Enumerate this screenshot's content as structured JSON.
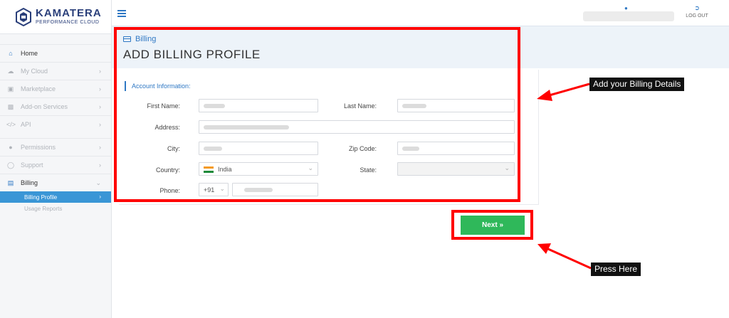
{
  "brand": {
    "name": "KAMATERA",
    "tagline": "PERFORMANCE CLOUD"
  },
  "sidebar": {
    "items": [
      {
        "label": "Home",
        "icon": "home-icon"
      },
      {
        "label": "My Cloud",
        "icon": "cloud-icon"
      },
      {
        "label": "Marketplace",
        "icon": "cart-icon"
      },
      {
        "label": "Add-on Services",
        "icon": "puzzle-icon"
      },
      {
        "label": "API",
        "icon": "code-icon"
      },
      {
        "label": "Permissions",
        "icon": "users-icon"
      },
      {
        "label": "Support",
        "icon": "lifebuoy-icon"
      },
      {
        "label": "Billing",
        "icon": "card-icon"
      }
    ],
    "sub_items": [
      {
        "label": "Billing Profile"
      },
      {
        "label": "Usage Reports"
      }
    ]
  },
  "topbar": {
    "logout_label": "LOG OUT"
  },
  "header": {
    "breadcrumb": "Billing",
    "title": "ADD BILLING PROFILE"
  },
  "form": {
    "section_title": "Account Information:",
    "first_name_label": "First Name:",
    "last_name_label": "Last Name:",
    "address_label": "Address:",
    "city_label": "City:",
    "zip_label": "Zip Code:",
    "country_label": "Country:",
    "country_value": "India",
    "state_label": "State:",
    "phone_label": "Phone:",
    "phone_code": "+91"
  },
  "actions": {
    "next_label": "Next »"
  },
  "annotations": {
    "billing_details": "Add your Billing Details",
    "press_here": "Press Here",
    "highlight_color": "#ff0000"
  },
  "colors": {
    "accent": "#2f78c4",
    "next_button": "#2fb85a",
    "active_nav": "#3a96d6"
  }
}
